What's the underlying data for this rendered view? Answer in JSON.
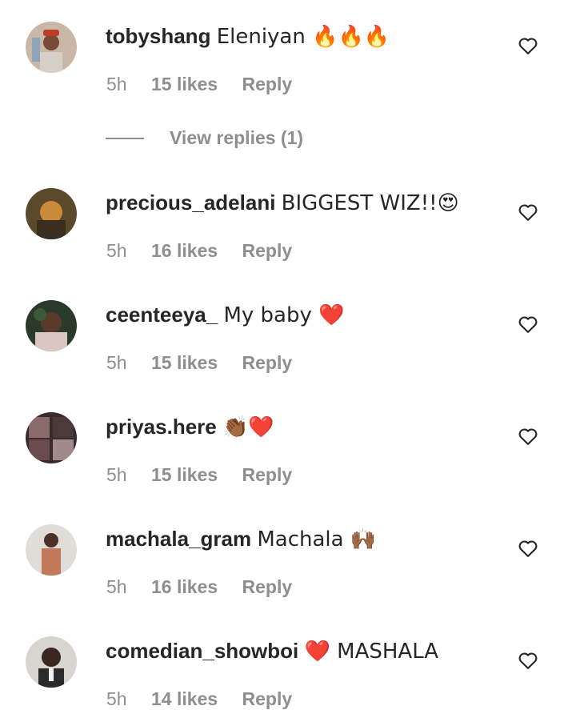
{
  "comments": [
    {
      "username": "tobyshang",
      "text": "Eleniyan 🔥🔥🔥",
      "time": "5h",
      "likes": "15 likes",
      "reply": "Reply"
    },
    {
      "username": "precious_adelani",
      "text": "BIGGEST WIZ!!😍",
      "time": "5h",
      "likes": "16 likes",
      "reply": "Reply"
    },
    {
      "username": "ceenteeya_",
      "text": "My baby ❤️",
      "time": "5h",
      "likes": "15 likes",
      "reply": "Reply"
    },
    {
      "username": "priyas.here",
      "text": "👏🏾❤️",
      "time": "5h",
      "likes": "15 likes",
      "reply": "Reply"
    },
    {
      "username": "machala_gram",
      "text": "Machala 🙌🏾",
      "time": "5h",
      "likes": "16 likes",
      "reply": "Reply"
    },
    {
      "username": "comedian_showboi",
      "text": "❤️ MASHALA",
      "time": "5h",
      "likes": "14 likes",
      "reply": "Reply"
    }
  ],
  "view_replies": "View replies (1)",
  "colors": {
    "text": "#262626",
    "muted": "#8e8e8e",
    "background": "#ffffff"
  }
}
